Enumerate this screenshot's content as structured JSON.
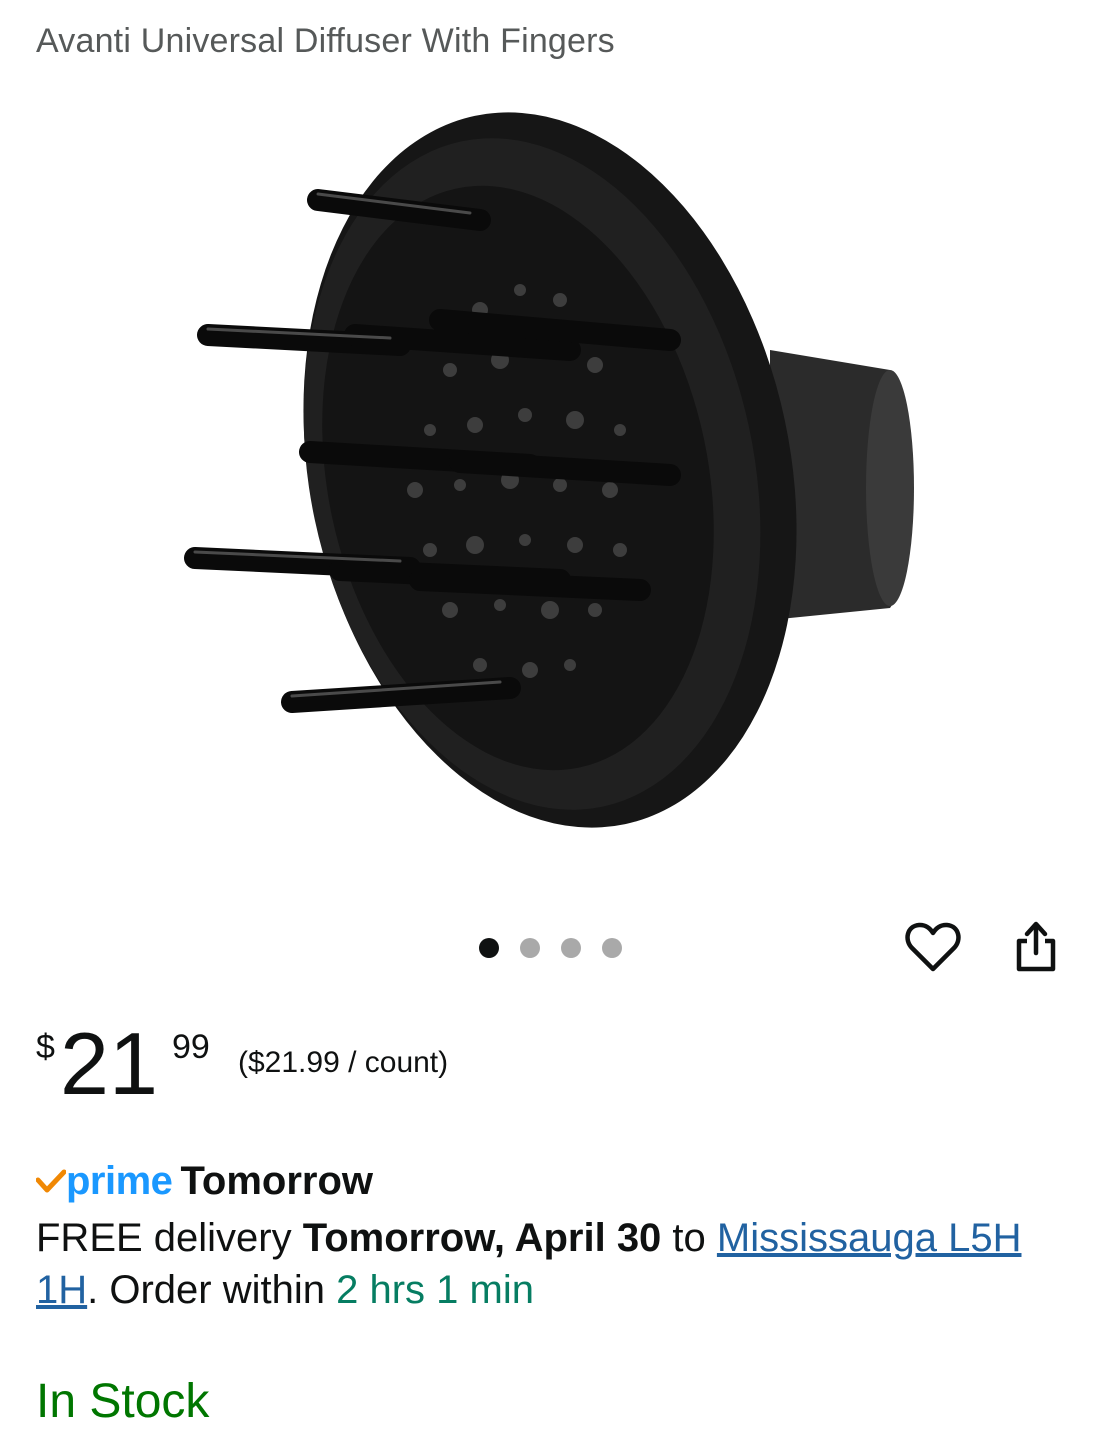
{
  "product": {
    "title": "Avanti Universal Diffuser With Fingers"
  },
  "gallery": {
    "image_count": 4,
    "active_index": 0
  },
  "actions": {
    "wishlist_icon": "heart-icon",
    "share_icon": "share-icon"
  },
  "price": {
    "symbol": "$",
    "whole": "21",
    "fraction": "99",
    "unit_price": "($21.99 / count)"
  },
  "prime": {
    "logo_text": "prime",
    "delivery_day": "Tomorrow"
  },
  "delivery": {
    "prefix": "FREE delivery ",
    "date": "Tomorrow, April 30",
    "to_text": " to ",
    "location": "Mississauga L5H 1H",
    "order_prefix": ". Order within ",
    "countdown": "2 hrs 1 min"
  },
  "stock": {
    "status": "In Stock"
  },
  "colors": {
    "prime_blue": "#1a98ff",
    "check_orange": "#f08804",
    "link_blue": "#2162a1",
    "countdown_teal": "#067d62",
    "stock_green": "#007600"
  }
}
